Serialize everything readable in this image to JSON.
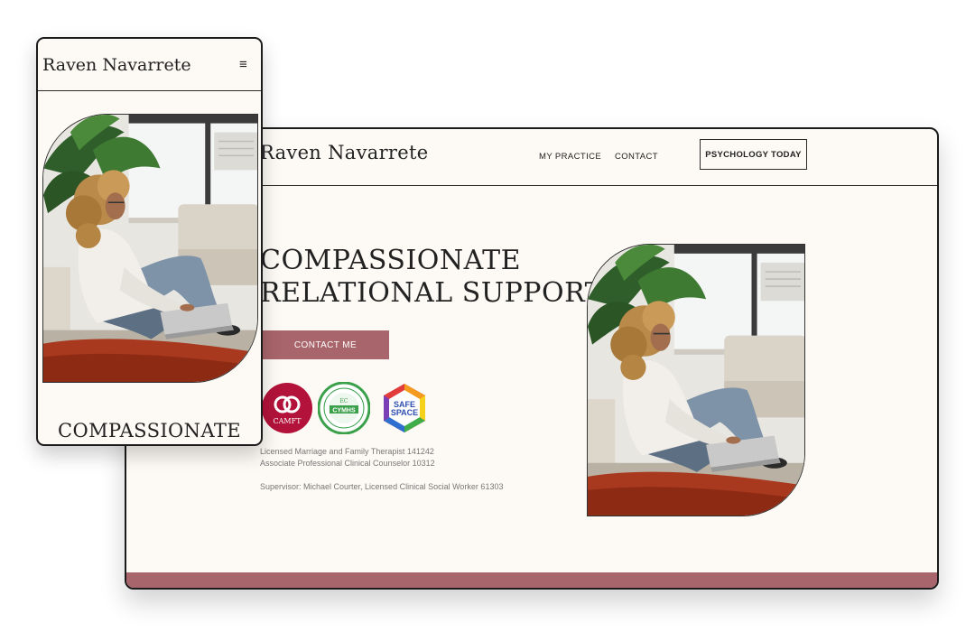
{
  "desktop": {
    "logo": "Raven Navarrete",
    "nav": {
      "practice": "MY PRACTICE",
      "contact": "CONTACT"
    },
    "psychology_today_label": "PSYCHOLOGY TODAY",
    "headline": [
      "COMPASSIONATE",
      "RELATIONAL SUPPORT"
    ],
    "cta_label": "CONTACT ME",
    "badges": {
      "camft": "CAMFT",
      "cymhs": "CYMHS",
      "safe_line1": "SAFE",
      "safe_line2": "SPACE"
    },
    "license_lines": [
      "Licensed Marriage and Family Therapist 141242",
      "Associate Professional Clinical Counselor 10312"
    ],
    "supervisor": "Supervisor: Michael Courter, Licensed Clinical Social Worker 61303"
  },
  "mobile": {
    "logo": "Raven Navarrete",
    "menu_icon": "≡",
    "headline": "COMPASSIONATE"
  },
  "colors": {
    "accent": "#a8656b",
    "background": "#fdfaf5",
    "camft_red": "#b3123a",
    "cymhs_green": "#3aa04a"
  },
  "icons": [
    "hamburger-menu-icon",
    "camft-badge-icon",
    "cymhs-badge-icon",
    "safe-space-badge-icon"
  ]
}
